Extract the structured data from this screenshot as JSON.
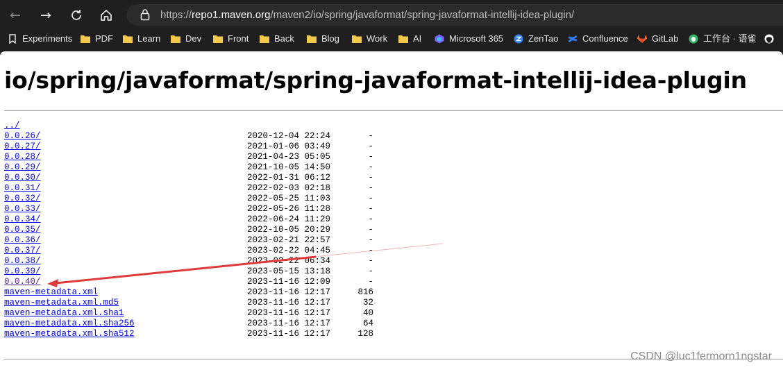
{
  "browser": {
    "url_scheme": "https://",
    "url_host": "repo1.maven.org",
    "url_path": "/maven2/io/spring/javaformat/spring-javaformat-intellij-idea-plugin/"
  },
  "bookmarks": [
    {
      "label": "Experiments",
      "icon": "bookmark-icon"
    },
    {
      "label": "PDF",
      "icon": "folder-icon"
    },
    {
      "label": "Learn",
      "icon": "folder-icon"
    },
    {
      "label": "Dev",
      "icon": "folder-icon"
    },
    {
      "label": "Front",
      "icon": "folder-icon"
    },
    {
      "label": "Back",
      "icon": "folder-icon"
    },
    {
      "label": "Blog",
      "icon": "folder-icon"
    },
    {
      "label": "Work",
      "icon": "folder-icon"
    },
    {
      "label": "AI",
      "icon": "folder-icon"
    },
    {
      "label": "Microsoft 365",
      "icon": "microsoft-365-icon"
    },
    {
      "label": "ZenTao",
      "icon": "zentao-icon"
    },
    {
      "label": "Confluence",
      "icon": "confluence-icon"
    },
    {
      "label": "GitLab",
      "icon": "gitlab-icon"
    },
    {
      "label": "工作台 · 语雀",
      "icon": "yuque-icon"
    },
    {
      "label": "",
      "icon": "github-icon"
    }
  ],
  "page": {
    "title": "io/spring/javaformat/spring-javaformat-intellij-idea-plugin",
    "entries": [
      {
        "name": "../",
        "date": "",
        "size": ""
      },
      {
        "name": "0.0.26/",
        "date": "2020-12-04 22:24",
        "size": "-"
      },
      {
        "name": "0.0.27/",
        "date": "2021-01-06 03:49",
        "size": "-"
      },
      {
        "name": "0.0.28/",
        "date": "2021-04-23 05:05",
        "size": "-"
      },
      {
        "name": "0.0.29/",
        "date": "2021-10-05 14:50",
        "size": "-"
      },
      {
        "name": "0.0.30/",
        "date": "2022-01-31 06:12",
        "size": "-"
      },
      {
        "name": "0.0.31/",
        "date": "2022-02-03 02:18",
        "size": "-"
      },
      {
        "name": "0.0.32/",
        "date": "2022-05-25 11:03",
        "size": "-"
      },
      {
        "name": "0.0.33/",
        "date": "2022-05-26 11:28",
        "size": "-"
      },
      {
        "name": "0.0.34/",
        "date": "2022-06-24 11:29",
        "size": "-"
      },
      {
        "name": "0.0.35/",
        "date": "2022-10-05 20:29",
        "size": "-"
      },
      {
        "name": "0.0.36/",
        "date": "2023-02-21 22:57",
        "size": "-"
      },
      {
        "name": "0.0.37/",
        "date": "2023-02-22 04:45",
        "size": "-"
      },
      {
        "name": "0.0.38/",
        "date": "2023-02-22 06:34",
        "size": "-"
      },
      {
        "name": "0.0.39/",
        "date": "2023-05-15 13:18",
        "size": "-"
      },
      {
        "name": "0.0.40/",
        "date": "2023-11-16 12:09",
        "size": "-",
        "visited": true
      },
      {
        "name": "maven-metadata.xml",
        "date": "2023-11-16 12:17",
        "size": "816"
      },
      {
        "name": "maven-metadata.xml.md5",
        "date": "2023-11-16 12:17",
        "size": "32"
      },
      {
        "name": "maven-metadata.xml.sha1",
        "date": "2023-11-16 12:17",
        "size": "40"
      },
      {
        "name": "maven-metadata.xml.sha256",
        "date": "2023-11-16 12:17",
        "size": "64"
      },
      {
        "name": "maven-metadata.xml.sha512",
        "date": "2023-11-16 12:17",
        "size": "128"
      }
    ]
  },
  "watermark": "CSDN @luc1fermorn1ngstar",
  "colors": {
    "chrome_bg": "#1f1f1f",
    "link": "#0000ee",
    "link_visited": "#551a8b",
    "annotation_arrow": "#e03a3a",
    "folder": "#f2c94c"
  }
}
